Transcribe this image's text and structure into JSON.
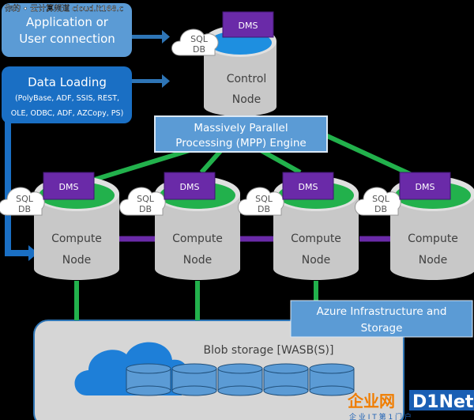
{
  "watermark": {
    "top": "你的 • 云计算频道 cloud.it168.c",
    "logo_cn": "企业网",
    "logo_en": "D1Net",
    "logo_sub": "企 业 I T 第 1 门 户"
  },
  "app_box": {
    "line1": "Application or",
    "line2": "User connection"
  },
  "loading_box": {
    "title": "Data Loading",
    "line1": "(PolyBase, ADF, SSIS, REST,",
    "line2": "OLE, ODBC, ADF, AZCopy, PS)"
  },
  "control": {
    "dms": "DMS",
    "sql1": "SQL",
    "sql2": "DB",
    "line1": "Control",
    "line2": "Node"
  },
  "mpp": {
    "line1": "Massively Parallel",
    "line2": "Processing (MPP) Engine"
  },
  "compute": [
    {
      "dms": "DMS",
      "sql1": "SQL",
      "sql2": "DB",
      "line1": "Compute",
      "line2": "Node"
    },
    {
      "dms": "DMS",
      "sql1": "SQL",
      "sql2": "DB",
      "line1": "Compute",
      "line2": "Node"
    },
    {
      "dms": "DMS",
      "sql1": "SQL",
      "sql2": "DB",
      "line1": "Compute",
      "line2": "Node"
    },
    {
      "dms": "DMS",
      "sql1": "SQL",
      "sql2": "DB",
      "line1": "Compute",
      "line2": "Node"
    }
  ],
  "azure": {
    "line1": "Azure Infrastructure and",
    "line2": "Storage"
  },
  "blob": {
    "label": "Blob storage [WASB(S)]"
  },
  "colors": {
    "light_blue": "#5b9bd5",
    "dark_blue": "#1a6fc4",
    "green": "#22b14c",
    "purple": "#6a2aa8",
    "gray": "#c8c8c8"
  }
}
